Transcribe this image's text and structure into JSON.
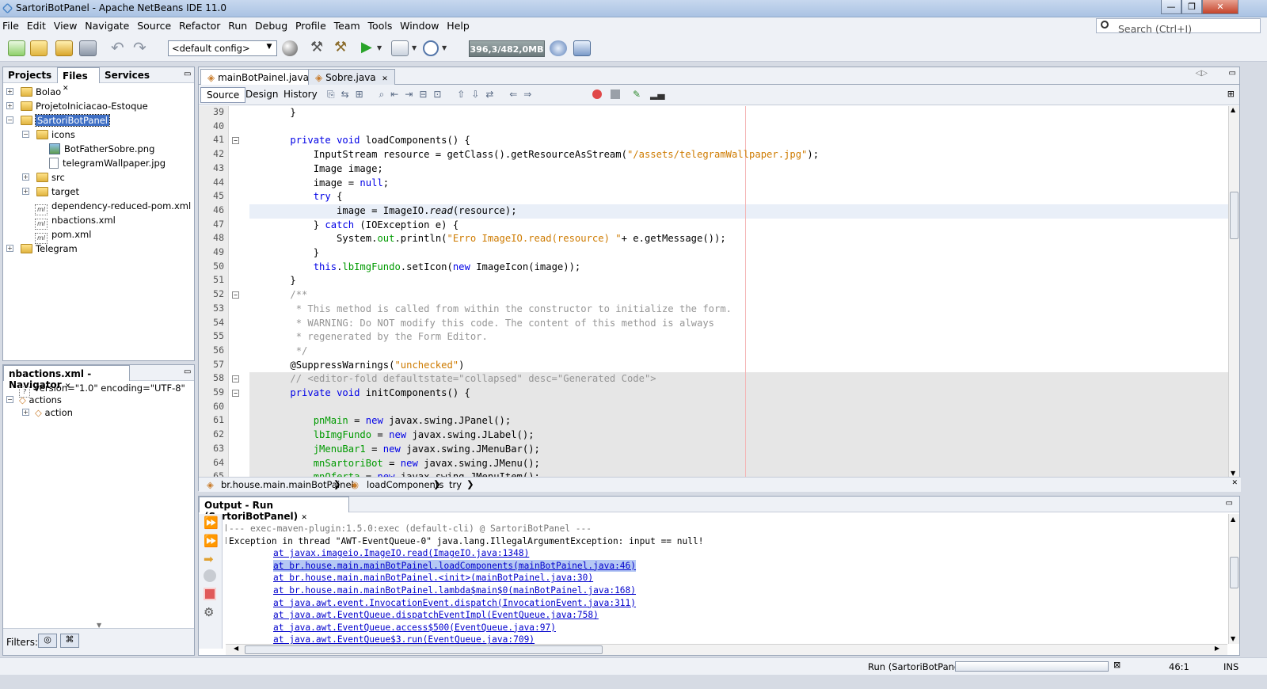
{
  "window": {
    "title": "SartoriBotPanel - Apache NetBeans IDE 11.0",
    "controls": [
      "—",
      "❐",
      "✕"
    ]
  },
  "menubar": {
    "items": [
      "File",
      "Edit",
      "View",
      "Navigate",
      "Source",
      "Refactor",
      "Run",
      "Debug",
      "Profile",
      "Team",
      "Tools",
      "Window",
      "Help"
    ],
    "search_placeholder": "Search (Ctrl+I)"
  },
  "toolbar": {
    "config": "<default config>",
    "memory": "396,3/482,0MB"
  },
  "projects_panel": {
    "tabs": [
      "Projects",
      "Files",
      "Services"
    ],
    "tree": [
      "Bolao",
      "ProjetoIniciacao-Estoque",
      "SartoriBotPanel",
      "icons",
      "BotFatherSobre.png",
      "telegramWallpaper.jpg",
      "src",
      "target",
      "dependency-reduced-pom.xml",
      "nbactions.xml",
      "pom.xml",
      "Telegram"
    ]
  },
  "navigator": {
    "title": "nbactions.xml - Navigator",
    "tree": [
      "version=\"1.0\" encoding=\"UTF-8\"",
      "actions",
      "action"
    ],
    "filters_label": "Filters:"
  },
  "editor": {
    "tabs": [
      "mainBotPainel.java",
      "Sobre.java"
    ],
    "subtabs": [
      "Source",
      "Design",
      "History"
    ],
    "line_numbers": [
      "39",
      "40",
      "41",
      "42",
      "43",
      "44",
      "45",
      "46",
      "47",
      "48",
      "49",
      "50",
      "51",
      "52",
      "53",
      "54",
      "55",
      "56",
      "57",
      "58",
      "59",
      "60",
      "61",
      "62",
      "63",
      "64",
      "65"
    ],
    "code": [
      "    }",
      "",
      "    private void loadComponents() {",
      "        InputStream resource = getClass().getResourceAsStream(\"/assets/telegramWallpaper.jpg\");",
      "        Image image;",
      "        image = null;",
      "        try {",
      "            image = ImageIO.read(resource);",
      "        } catch (IOException e) {",
      "            System.out.println(\"Erro ImageIO.read(resource) \"+ e.getMessage());",
      "        }",
      "        this.lbImgFundo.setIcon(new ImageIcon(image));",
      "    }",
      "    /**",
      "     * This method is called from within the constructor to initialize the form.",
      "     * WARNING: Do NOT modify this code. The content of this method is always",
      "     * regenerated by the Form Editor.",
      "     */",
      "    @SuppressWarnings(\"unchecked\")",
      "    // <editor-fold defaultstate=\"collapsed\" desc=\"Generated Code\">",
      "    private void initComponents() {",
      "",
      "        pnMain = new javax.swing.JPanel();",
      "        lbImgFundo = new javax.swing.JLabel();",
      "        jMenuBar1 = new javax.swing.JMenuBar();",
      "        mnSartoriBot = new javax.swing.JMenu();",
      "        mnOferta = new javax.swing.JMenuItem();"
    ],
    "breadcrumb": [
      "br.house.main.mainBotPainel",
      "loadComponents",
      "try"
    ]
  },
  "output": {
    "title": "Output - Run (SartoriBotPanel)",
    "lines": [
      "--- exec-maven-plugin:1.5.0:exec (default-cli) @ SartoriBotPanel ---",
      "Exception in thread \"AWT-EventQueue-0\" java.lang.IllegalArgumentException: input == null!",
      "at javax.imageio.ImageIO.read(ImageIO.java:1348)",
      "at br.house.main.mainBotPainel.loadComponents(mainBotPainel.java:46)",
      "at br.house.main.mainBotPainel.<init>(mainBotPainel.java:30)",
      "at br.house.main.mainBotPainel.lambda$main$0(mainBotPainel.java:168)",
      "at java.awt.event.InvocationEvent.dispatch(InvocationEvent.java:311)",
      "at java.awt.EventQueue.dispatchEventImpl(EventQueue.java:758)",
      "at java.awt.EventQueue.access$500(EventQueue.java:97)",
      "at java.awt.EventQueue$3.run(EventQueue.java:709)"
    ]
  },
  "statusbar": {
    "run_label": "Run (SartoriBotPanel)",
    "position": "46:1",
    "mode": "INS"
  },
  "colors": {
    "keyword": "#0000e6",
    "string": "#ce7b00",
    "comment": "#969696",
    "field": "#009a00",
    "link": "#0000cc"
  }
}
